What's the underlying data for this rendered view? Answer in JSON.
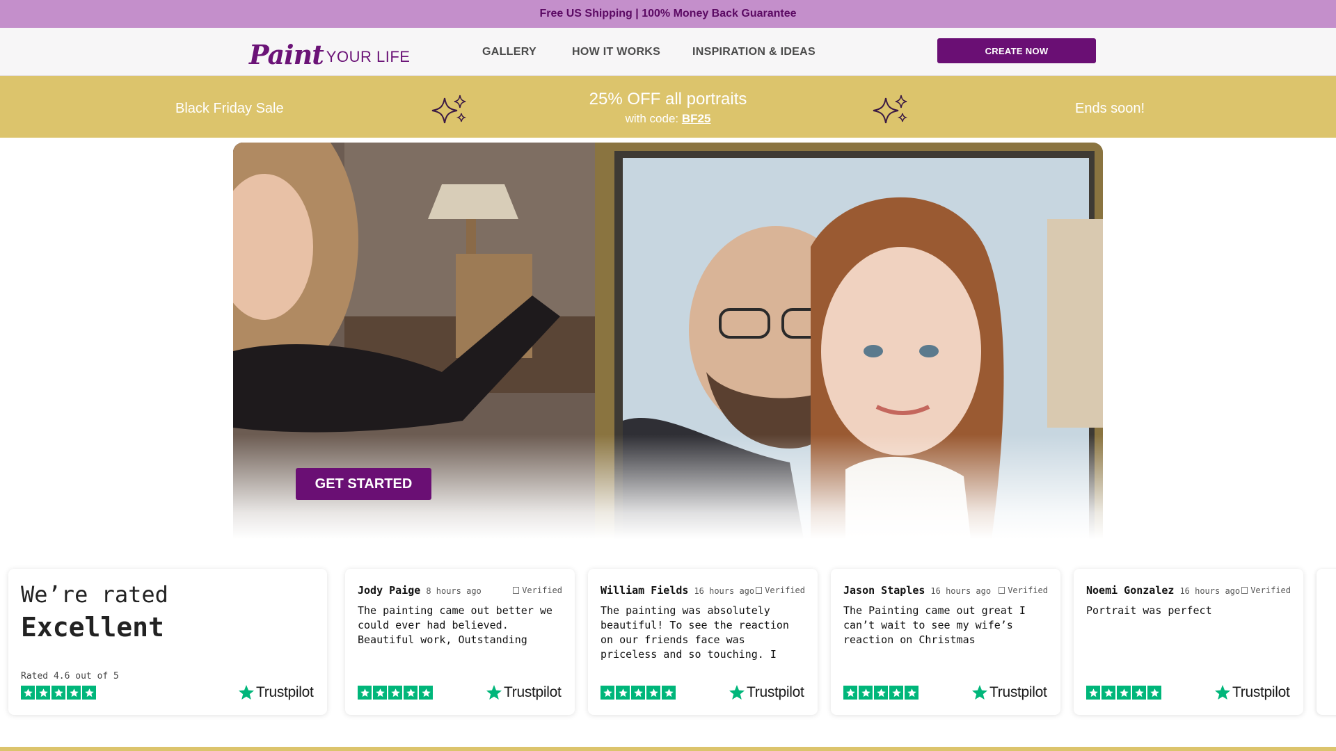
{
  "promo_bar": {
    "text": "Free US Shipping | 100% Money Back Guarantee"
  },
  "header": {
    "logo": {
      "script": "Paint",
      "rest": "YOUR LIFE"
    },
    "nav": [
      {
        "label": "GALLERY"
      },
      {
        "label": "HOW IT WORKS"
      },
      {
        "label": "INSPIRATION & IDEAS"
      }
    ],
    "cta_label": "CREATE NOW"
  },
  "sale_banner": {
    "left": "Black Friday Sale",
    "headline": "25% OFF all portraits",
    "code_prefix": "with code: ",
    "code": "BF25",
    "right": "Ends soon!",
    "icon": "sparkle-icon"
  },
  "hero": {
    "button_label": "GET STARTED"
  },
  "rating": {
    "line1": "We’re rated",
    "line2": "Excellent",
    "small": "Rated 4.6 out of 5",
    "stars": 5,
    "brand": "Trustpilot"
  },
  "reviews": [
    {
      "name": "Jody Paige",
      "time": "8 hours ago",
      "verified": "Verified",
      "body": "The painting came out better we could ever had believed. Beautiful work, Outstanding",
      "stars": 5,
      "brand": "Trustpilot"
    },
    {
      "name": "William Fields",
      "time": "16 hours ago",
      "verified": "Verified",
      "body": "The painting was absolutely beautiful! To see the reaction on our friends face was priceless and so touching. I",
      "stars": 5,
      "brand": "Trustpilot"
    },
    {
      "name": "Jason Staples",
      "time": "16 hours ago",
      "verified": "Verified",
      "body": "The Painting came out great I can’t wait to see my wife’s reaction on Christmas",
      "stars": 5,
      "brand": "Trustpilot"
    },
    {
      "name": "Noemi Gonzalez",
      "time": "16 hours ago",
      "verified": "Verified",
      "body": "Portrait was perfect",
      "stars": 5,
      "brand": "Trustpilot"
    }
  ],
  "colors": {
    "promo_bg": "#c48fcb",
    "brand_purple": "#6a0f74",
    "banner_gold": "#dcc46c",
    "trustpilot_green": "#00b67a"
  }
}
